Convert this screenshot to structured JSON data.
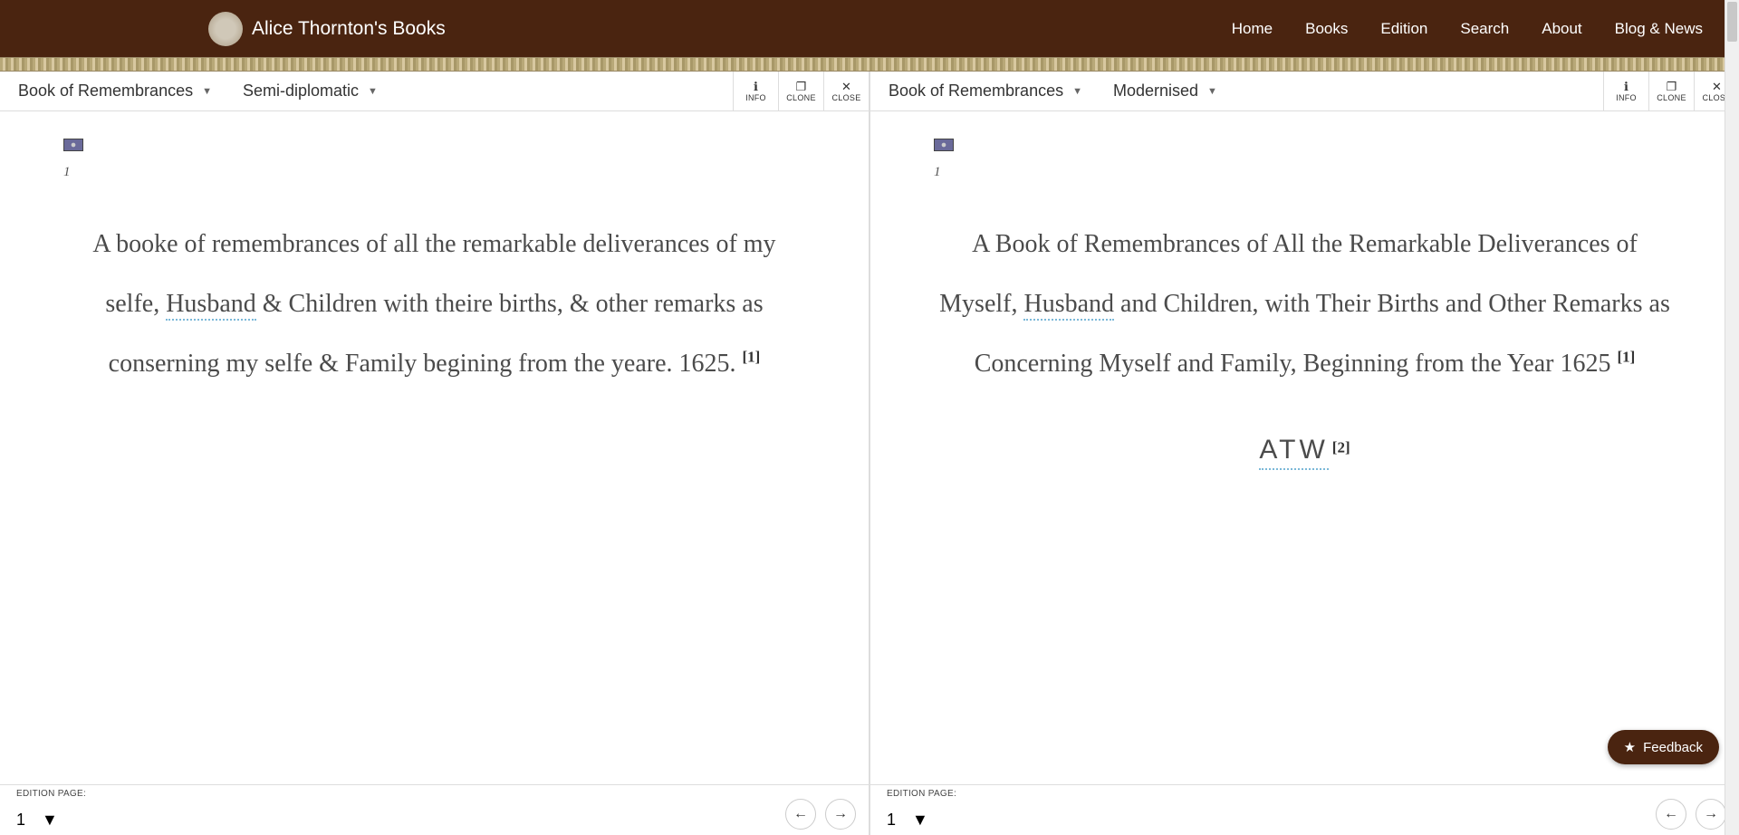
{
  "brand": {
    "title": "Alice Thornton's Books"
  },
  "nav": {
    "home": "Home",
    "books": "Books",
    "edition": "Edition",
    "search": "Search",
    "about": "About",
    "blog": "Blog & News"
  },
  "toolbar": {
    "info": "INFO",
    "clone": "CLONE",
    "close": "CLOSE"
  },
  "footer": {
    "edition_page_label": "EDITION PAGE:"
  },
  "feedback": {
    "label": "Feedback"
  },
  "panes": [
    {
      "book": "Book of Remembrances",
      "version": "Semi-diplomatic",
      "page_marker": "1",
      "title_pre": "A booke of remembrances of all the remarkable deliverances of my selfe, ",
      "title_term": "Husband",
      "title_post": " & Children with theire births, & other remarks as conserning my selfe & Family begining from the yeare. 1625.",
      "note1": "[1]",
      "current_page": "1"
    },
    {
      "book": "Book of Remembrances",
      "version": "Modernised",
      "page_marker": "1",
      "title_pre": "A Book of Remembrances of All the Remarkable Deliverances of Myself, ",
      "title_term": "Husband",
      "title_post": " and Children, with Their Births and Other Remarks as Concerning Myself and Family, Beginning from the Year 1625",
      "note1": "[1]",
      "signature": "ATW",
      "note2": "[2]",
      "current_page": "1"
    }
  ]
}
